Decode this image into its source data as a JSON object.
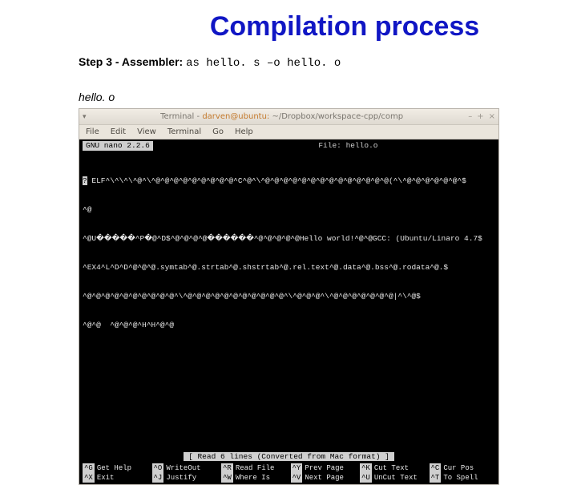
{
  "title": "Compilation process",
  "step": {
    "label": "Step 3 - Assembler:",
    "command": "as hello. s –o hello. o"
  },
  "file_label": "hello. o",
  "window": {
    "title_prefix": "Terminal - ",
    "user": "darven@ubuntu:",
    "path": " ~/Dropbox/workspace-cpp/comp",
    "btn_min": "–",
    "btn_max": "+",
    "btn_close": "×"
  },
  "menu": [
    "File",
    "Edit",
    "View",
    "Terminal",
    "Go",
    "Help"
  ],
  "nano": {
    "version": "GNU nano 2.2.6",
    "file_label": "File: hello.o"
  },
  "content": [
    "? ELF^\\^\\^\\^@^\\^@^@^@^@^@^@^@^@^@^C^@^\\^@^@^@^@^@^@^@^@^@^@^@^@^@^@(^\\^@^@^@^@^@^@^$",
    "^@",
    "^@U�����^P�@^D$^@^@^@^@������^@^@^@^@^@Hello world!^@^@GCC: (Ubuntu/Linaro 4.7$",
    "^EX4^L^D^D^@^@^@.symtab^@.strtab^@.shstrtab^@.rel.text^@.data^@.bss^@.rodata^@.$",
    "^@^@^@^@^@^@^@^@^@^@^\\^@^@^@^@^@^@^@^@^@^@^@^\\^@^@^@^\\^@^@^@^@^@^@^@|^\\^@$",
    "^@^@  ^@^@^@^H^H^@^@"
  ],
  "status": "[ Read 6 lines (Converted from Mac format) ]",
  "shortcuts": [
    {
      "key": "^G",
      "label": "Get Help"
    },
    {
      "key": "^O",
      "label": "WriteOut"
    },
    {
      "key": "^R",
      "label": "Read File"
    },
    {
      "key": "^Y",
      "label": "Prev Page"
    },
    {
      "key": "^K",
      "label": "Cut Text"
    },
    {
      "key": "^C",
      "label": "Cur Pos"
    },
    {
      "key": "^X",
      "label": "Exit"
    },
    {
      "key": "^J",
      "label": "Justify"
    },
    {
      "key": "^W",
      "label": "Where Is"
    },
    {
      "key": "^V",
      "label": "Next Page"
    },
    {
      "key": "^U",
      "label": "UnCut Text"
    },
    {
      "key": "^T",
      "label": "To Spell"
    }
  ]
}
